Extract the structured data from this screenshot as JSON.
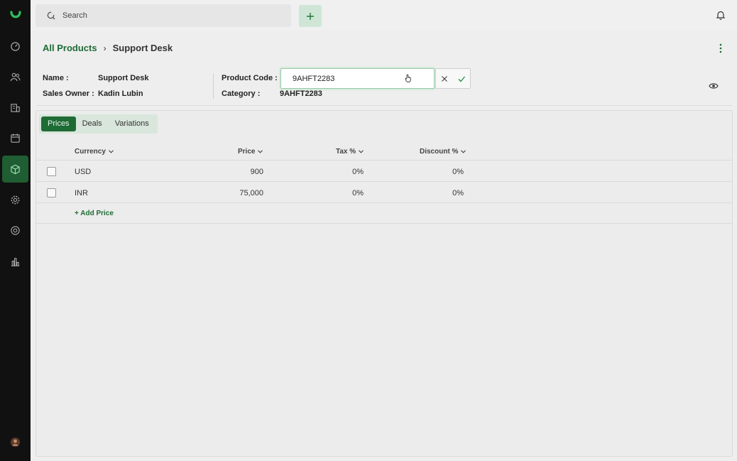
{
  "search": {
    "placeholder": "Search"
  },
  "breadcrumb": {
    "root": "All Products",
    "current": "Support Desk"
  },
  "details": {
    "name_label": "Name :",
    "name_value": "Support Desk",
    "owner_label": "Sales Owner :",
    "owner_value": "Kadin Lubin",
    "code_label": "Product Code :",
    "code_value": "9AHFT2283",
    "category_label": "Category :",
    "category_value": "9AHFT2283"
  },
  "tabs": [
    "Prices",
    "Deals",
    "Variations"
  ],
  "table": {
    "headers": [
      "Currency",
      "Price",
      "Tax %",
      "Discount %"
    ],
    "rows": [
      {
        "currency": "USD",
        "price": "900",
        "tax": "0%",
        "discount": "0%"
      },
      {
        "currency": "INR",
        "price": "75,000",
        "tax": "0%",
        "discount": "0%"
      }
    ],
    "add_label": "+ Add Price"
  },
  "colors": {
    "accent": "#1f6b35",
    "sidebar": "#111111"
  }
}
